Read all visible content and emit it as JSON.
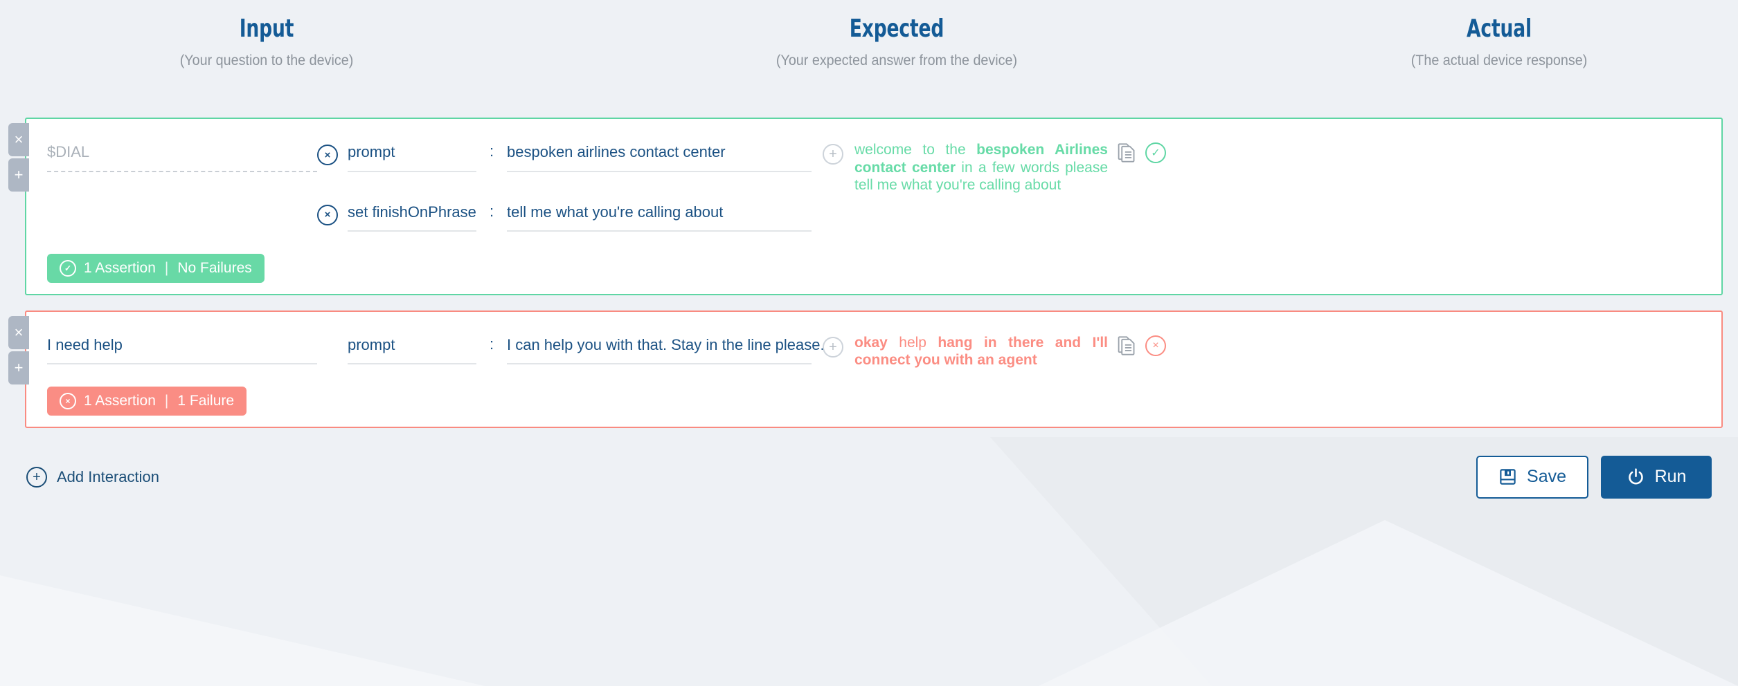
{
  "columns": [
    {
      "title": "Input",
      "subtitle": "(Your question to the device)"
    },
    {
      "title": "Expected",
      "subtitle": "(Your expected answer from the device)"
    },
    {
      "title": "Actual",
      "subtitle": "(The actual device response)"
    }
  ],
  "side_tabs": {
    "delete_label": "×",
    "add_label": "+"
  },
  "interactions": [
    {
      "status": "pass",
      "input": {
        "value": "",
        "placeholder": "$DIAL"
      },
      "rows": [
        {
          "has_remove": true,
          "remove_label": "×",
          "key": "prompt",
          "colon": ":",
          "value": "bespoken airlines contact center",
          "has_plus": true,
          "plus_label": "+"
        },
        {
          "has_remove": true,
          "remove_label": "×",
          "key": "set finishOnPhrase",
          "colon": ":",
          "value": "tell me what you're calling about",
          "has_plus": false,
          "plus_label": "+"
        }
      ],
      "actual": {
        "segments": [
          {
            "text": "welcome to the ",
            "bold": false
          },
          {
            "text": "bespoken Airlines contact center",
            "bold": true
          },
          {
            "text": " in a few words please tell me what you're calling about",
            "bold": false
          }
        ],
        "copy_icon": "copy-icon",
        "status_icon": "check-circle-icon",
        "status_glyph": "✓"
      },
      "badge": {
        "icon_glyph": "✓",
        "assertions": "1 Assertion",
        "separator": "|",
        "result": "No Failures"
      }
    },
    {
      "status": "fail",
      "input": {
        "value": "I need help",
        "placeholder": ""
      },
      "rows": [
        {
          "has_remove": false,
          "remove_label": "×",
          "key": "prompt",
          "colon": ":",
          "value": "I can help you with that. Stay in the line please.",
          "has_plus": true,
          "plus_label": "+"
        }
      ],
      "actual": {
        "segments": [
          {
            "text": "okay",
            "bold": true
          },
          {
            "text": " help ",
            "bold": false
          },
          {
            "text": "hang in there and I'll connect you with an agent",
            "bold": true
          }
        ],
        "copy_icon": "copy-icon",
        "status_icon": "x-circle-icon",
        "status_glyph": "×"
      },
      "badge": {
        "icon_glyph": "×",
        "assertions": "1 Assertion",
        "separator": "|",
        "result": "1 Failure"
      }
    }
  ],
  "footer": {
    "add_interaction": {
      "label": "Add Interaction",
      "icon_glyph": "+"
    },
    "save_button": {
      "label": "Save",
      "icon": "floppy-disk-icon"
    },
    "run_button": {
      "label": "Run",
      "icon": "power-icon"
    }
  },
  "colors": {
    "pass": "#68d9a6",
    "fail": "#fa8d84",
    "brand_blue": "#145b96",
    "text_blue": "#1b5183",
    "page_bg": "#eef1f5"
  }
}
